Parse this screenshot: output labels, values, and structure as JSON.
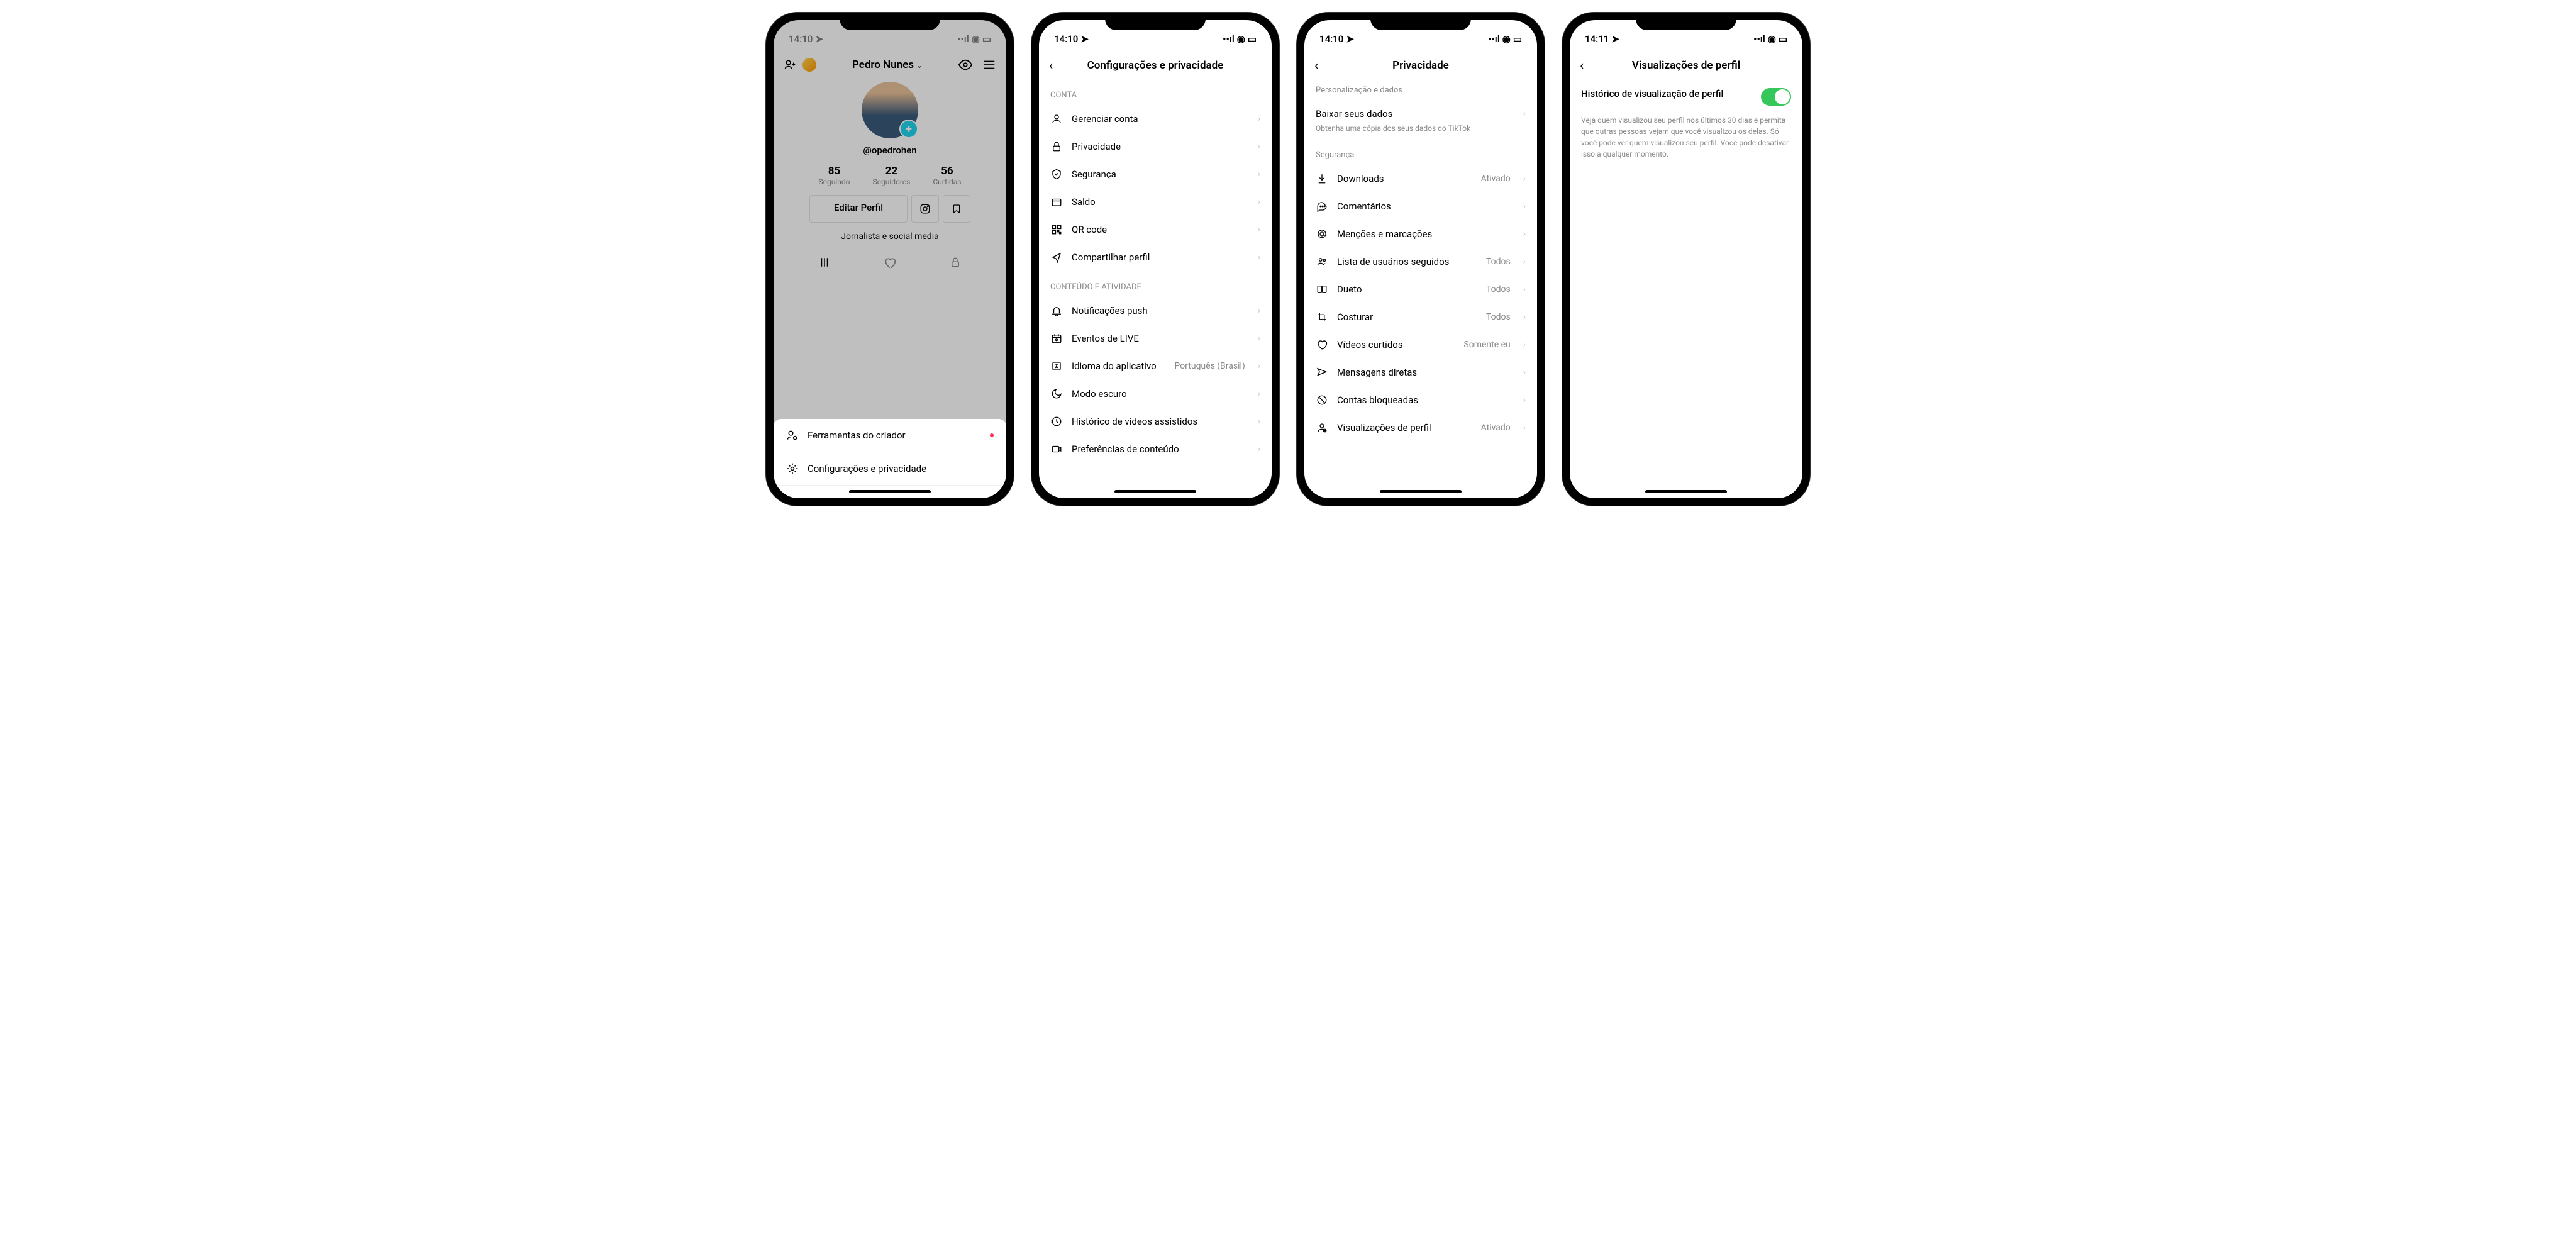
{
  "phone1": {
    "time": "14:10",
    "profile_name": "Pedro Nunes",
    "handle": "@opedrohen",
    "stats": [
      {
        "num": "85",
        "label": "Seguindo"
      },
      {
        "num": "22",
        "label": "Seguidores"
      },
      {
        "num": "56",
        "label": "Curtidas"
      }
    ],
    "edit_btn": "Editar Perfil",
    "bio": "Jornalista e social media",
    "sheet": [
      {
        "label": "Ferramentas do criador",
        "has_dot": true
      },
      {
        "label": "Configurações e privacidade",
        "has_dot": false
      }
    ]
  },
  "phone2": {
    "time": "14:10",
    "title": "Configurações e privacidade",
    "section1": "CONTA",
    "items1": [
      {
        "icon": "person",
        "label": "Gerenciar conta"
      },
      {
        "icon": "lock",
        "label": "Privacidade"
      },
      {
        "icon": "shield",
        "label": "Segurança"
      },
      {
        "icon": "wallet",
        "label": "Saldo"
      },
      {
        "icon": "qr",
        "label": "QR code"
      },
      {
        "icon": "share",
        "label": "Compartilhar perfil"
      }
    ],
    "section2": "CONTEÚDO E ATIVIDADE",
    "items2": [
      {
        "icon": "bell",
        "label": "Notificações push"
      },
      {
        "icon": "calendar",
        "label": "Eventos de LIVE"
      },
      {
        "icon": "lang",
        "label": "Idioma do aplicativo",
        "value": "Português (Brasil)"
      },
      {
        "icon": "moon",
        "label": "Modo escuro"
      },
      {
        "icon": "history",
        "label": "Histórico de vídeos assistidos"
      },
      {
        "icon": "video",
        "label": "Preferências de conteúdo"
      }
    ]
  },
  "phone3": {
    "time": "14:10",
    "title": "Privacidade",
    "section1": "Personalização e dados",
    "download_label": "Baixar seus dados",
    "download_sub": "Obtenha uma cópia dos seus dados do TikTok",
    "section2": "Segurança",
    "items": [
      {
        "icon": "download",
        "label": "Downloads",
        "value": "Ativado"
      },
      {
        "icon": "comment",
        "label": "Comentários"
      },
      {
        "icon": "mention",
        "label": "Menções e marcações"
      },
      {
        "icon": "users",
        "label": "Lista de usuários seguidos",
        "value": "Todos"
      },
      {
        "icon": "duet",
        "label": "Dueto",
        "value": "Todos"
      },
      {
        "icon": "stitch",
        "label": "Costurar",
        "value": "Todos"
      },
      {
        "icon": "heart",
        "label": "Vídeos curtidos",
        "value": "Somente eu"
      },
      {
        "icon": "message",
        "label": "Mensagens diretas"
      },
      {
        "icon": "blocked",
        "label": "Contas bloqueadas"
      },
      {
        "icon": "views",
        "label": "Visualizações de perfil",
        "value": "Ativado"
      }
    ]
  },
  "phone4": {
    "time": "14:11",
    "title": "Visualizações de perfil",
    "toggle_label": "Histórico de visualização de perfil",
    "toggle_desc": "Veja quem visualizou seu perfil nos últimos 30 dias e permita que outras pessoas vejam que você visualizou os delas. Só você pode ver quem visualizou seu perfil. Você pode desativar isso a qualquer momento."
  }
}
